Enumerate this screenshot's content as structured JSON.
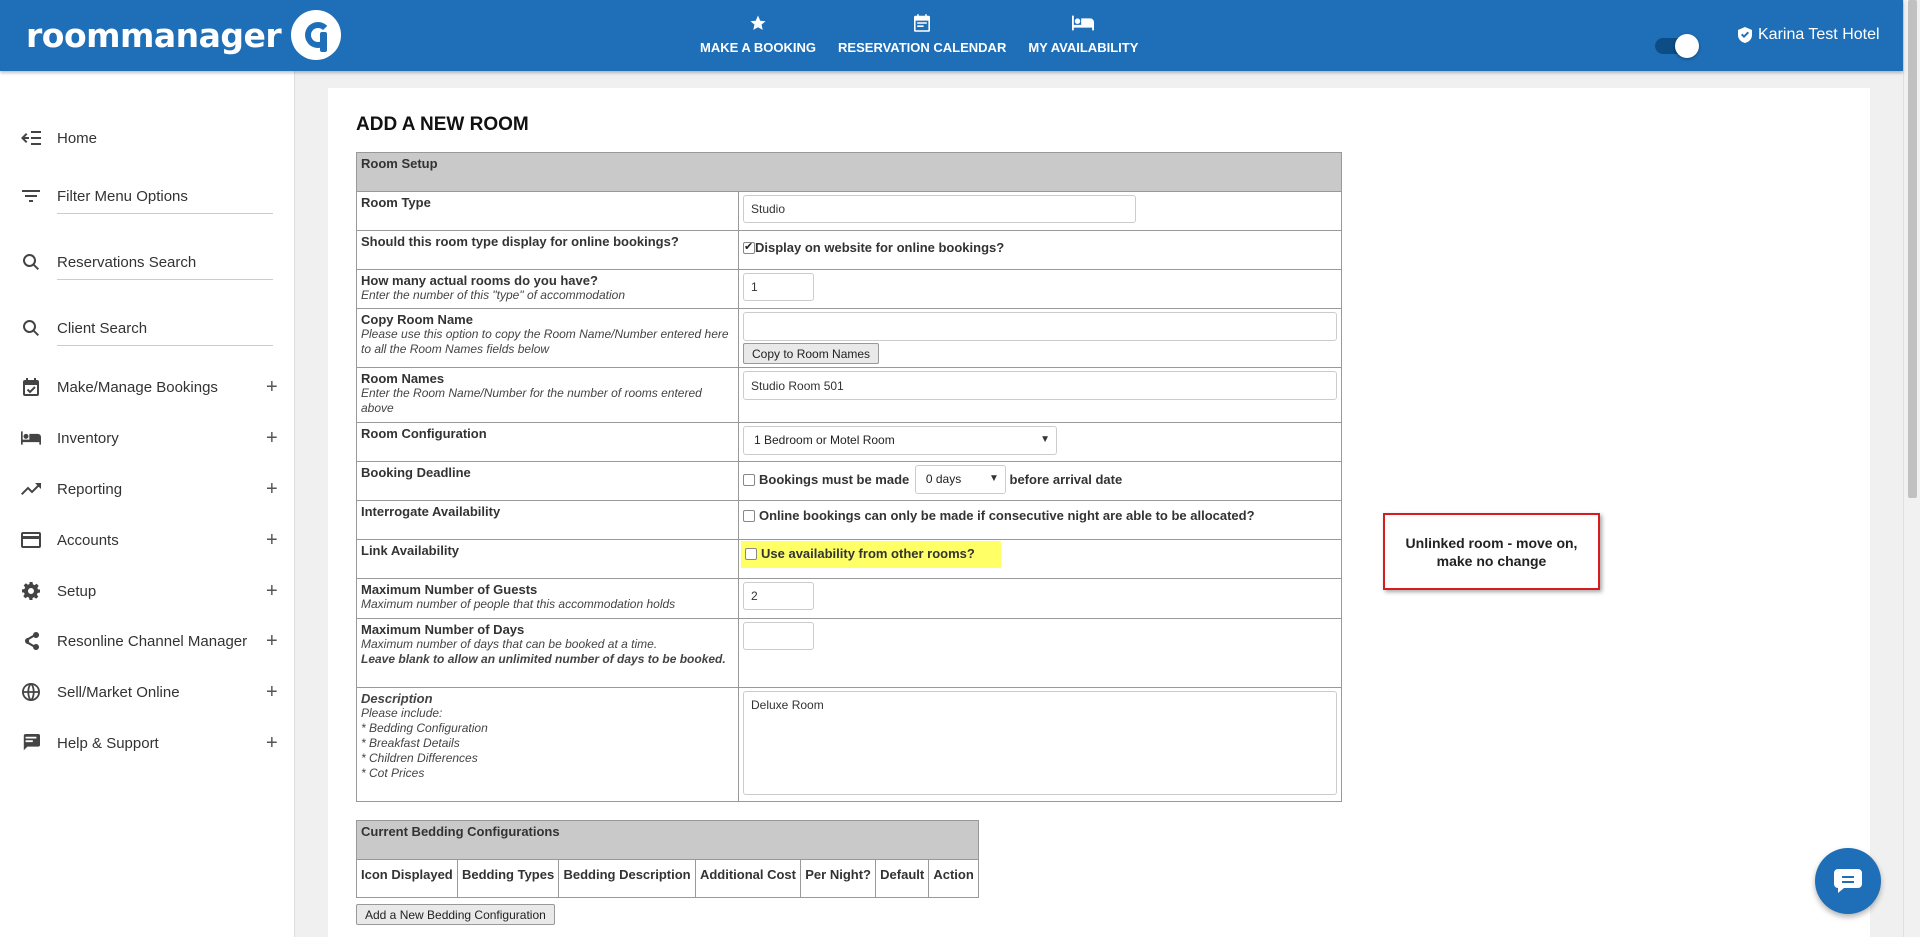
{
  "app": {
    "logo_text": "roommanager",
    "hotel_name": "Karina Test Hotel"
  },
  "topnav": [
    {
      "label": "MAKE A BOOKING",
      "icon": "star-icon"
    },
    {
      "label": "RESERVATION CALENDAR",
      "icon": "calendar-icon"
    },
    {
      "label": "MY AVAILABILITY",
      "icon": "bed-icon"
    }
  ],
  "sidebar": {
    "items": [
      {
        "label": "Home",
        "icon": "back-arrow-icon"
      },
      {
        "label": "Filter Menu Options",
        "icon": "filter-icon"
      },
      {
        "label": "Reservations Search",
        "icon": "search-icon"
      },
      {
        "label": "Client Search",
        "icon": "search-icon"
      },
      {
        "label": "Make/Manage Bookings",
        "icon": "event-check-icon"
      },
      {
        "label": "Inventory",
        "icon": "bed-icon"
      },
      {
        "label": "Reporting",
        "icon": "trending-up-icon"
      },
      {
        "label": "Accounts",
        "icon": "credit-card-icon"
      },
      {
        "label": "Setup",
        "icon": "gear-icon"
      },
      {
        "label": "Resonline Channel Manager",
        "icon": "share-icon"
      },
      {
        "label": "Sell/Market Online",
        "icon": "globe-icon"
      },
      {
        "label": "Help & Support",
        "icon": "chat-icon"
      }
    ],
    "expand_symbol": "+"
  },
  "page": {
    "title": "ADD A NEW ROOM"
  },
  "form": {
    "section_header": "Room Setup",
    "room_type": {
      "label": "Room Type",
      "value": "Studio"
    },
    "online_display": {
      "label": "Should this room type display for online bookings?",
      "checkbox_label": "Display on website for online bookings?",
      "checked": true
    },
    "room_count": {
      "label": "How many actual rooms do you have?",
      "hint": "Enter the number of this \"type\" of accommodation",
      "value": "1"
    },
    "copy_room_name": {
      "label": "Copy Room Name",
      "hint": "Please use this option to copy the Room Name/Number entered here to all the Room Names fields below",
      "value": "",
      "button": "Copy to Room Names"
    },
    "room_names": {
      "label": "Room Names",
      "hint": "Enter the Room Name/Number for the number of rooms entered above",
      "value": "Studio Room 501"
    },
    "room_configuration": {
      "label": "Room Configuration",
      "selected": "1 Bedroom or Motel Room"
    },
    "booking_deadline": {
      "label": "Booking Deadline",
      "checkbox_label": "Bookings must be made",
      "selected": "0 days",
      "suffix": "before arrival date",
      "checked": false
    },
    "interrogate_availability": {
      "label": "Interrogate Availability",
      "checkbox_label": "Online bookings can only be made if consecutive night are able to be allocated?",
      "checked": false
    },
    "link_availability": {
      "label": "Link Availability",
      "checkbox_label": "Use availability from other rooms?",
      "checked": false
    },
    "max_guests": {
      "label": "Maximum Number of Guests",
      "hint": "Maximum number of people that this accommodation holds",
      "value": "2"
    },
    "max_days": {
      "label": "Maximum Number of Days",
      "hint": "Maximum number of days that can be booked at a time.",
      "hint_bold": "Leave blank to allow an unlimited number of days to be booked.",
      "value": ""
    },
    "description": {
      "label": "Description",
      "hint_lines": [
        "Please include:",
        "* Bedding Configuration",
        "* Breakfast Details",
        "* Children Differences",
        "* Cot Prices"
      ],
      "value": "Deluxe Room"
    }
  },
  "bedding": {
    "header": "Current Bedding Configurations",
    "columns": [
      "Icon Displayed",
      "Bedding Types",
      "Bedding Description",
      "Additional Cost",
      "Per Night?",
      "Default",
      "Action"
    ],
    "add_button": "Add a New Bedding Configuration"
  },
  "annotation": {
    "text": "Unlinked room - move on, make no change",
    "border_color": "#d61c1c"
  },
  "colors": {
    "brand": "#1f6fb8",
    "highlight": "#ffff66",
    "table_header": "#c9c9c9"
  }
}
